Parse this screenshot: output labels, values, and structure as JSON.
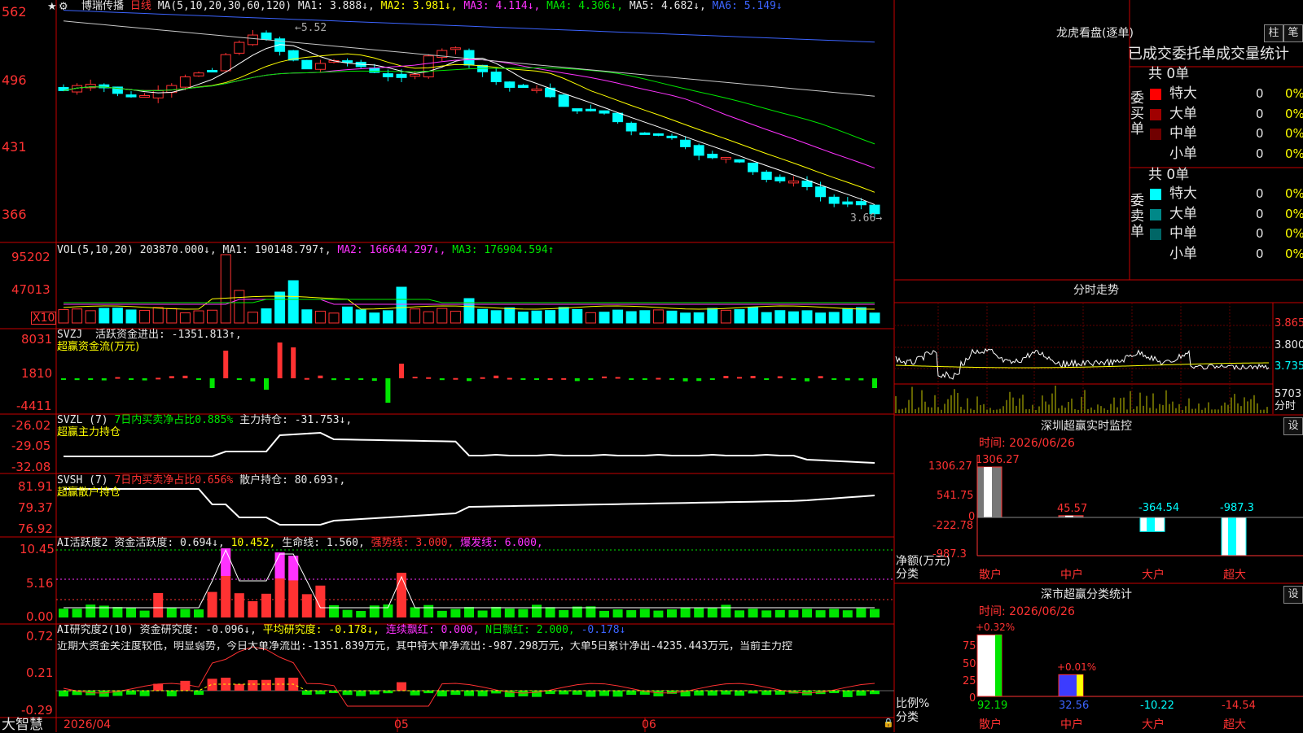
{
  "main": {
    "title_stock": "博瑞传播",
    "title_period": "日线",
    "ma_def": "MA(5,10,20,30,60,120)",
    "ma1": "MA1: 3.888↓,",
    "ma2": "MA2: 3.981↓,",
    "ma3": "MA3: 4.114↓,",
    "ma4": "MA4: 4.306↓,",
    "ma5": "MA5: 4.682↓,",
    "ma6": "MA6: 5.149↓",
    "y_labels": [
      "562",
      "496",
      "431",
      "366"
    ],
    "high_label": "5.52",
    "low_label": "3.66",
    "colors": {
      "ma1": "#ffffff",
      "ma2": "#ffff00",
      "ma3": "#ff32ff",
      "ma4": "#00e600",
      "ma5": "#c8c8c8",
      "ma6": "#3c64ff"
    }
  },
  "vol": {
    "def": "VOL(5,10,20)",
    "value": "203870.000↓,",
    "ma1": "MA1: 190148.797↑,",
    "ma2": "MA2: 166644.297↓,",
    "ma3": "MA3: 176904.594↑",
    "y_labels": [
      "95202",
      "47013"
    ],
    "unit": "X10"
  },
  "svzj": {
    "name": "SVZJ",
    "line1": "活跃资金进出: -1351.813↑,",
    "line2": "超赢资金流(万元)",
    "y_labels": [
      "8031",
      "1810",
      "-4411"
    ]
  },
  "svzl": {
    "name": "SVZL (7)",
    "ratio": "7日内买卖净占比0.885%",
    "hold": "主力持仓: -31.753↓,",
    "line2": "超赢主力持仓",
    "y_labels": [
      "-26.02",
      "-29.05",
      "-32.08"
    ]
  },
  "svsh": {
    "name": "SVSH (7)",
    "ratio": "7日内买卖净占比0.656%",
    "hold": "散户持仓: 80.693↑,",
    "line2": "超赢散户持仓",
    "y_labels": [
      "81.91",
      "79.37",
      "76.92"
    ]
  },
  "ai1": {
    "name": "AI活跃度2",
    "v1": "资金活跃度: 0.694↓,",
    "v2": "10.452,",
    "v3": "生命线: 1.560,",
    "v4": "强势线: 3.000,",
    "v5": "爆发线: 6.000,",
    "y_labels": [
      "10.45",
      "5.16",
      "0.00"
    ]
  },
  "ai2": {
    "name": "AI研究度2(10)",
    "v1": "资金研究度: -0.096↓,",
    "v2": "平均研究度: -0.178↓,",
    "v3": "连续飘红: 0.000,",
    "v4": "N日飘红: 2.000,",
    "v5": "-0.178↓",
    "comment": "近期大资金关注度较低，明显弱势，今日大单净流出:-1351.839万元，其中特大单净流出:-987.298万元，大单5日累计净出-4235.443万元，当前主力控",
    "y_labels": [
      "0.72",
      "0.21",
      "-0.29"
    ]
  },
  "bottom": {
    "brand": "大智慧",
    "dates": [
      "2026/04",
      "05",
      "06"
    ]
  },
  "longhu": {
    "title": "龙虎看盘(逐单)",
    "btn1": "柱",
    "btn2": "笔",
    "subtitle": "已成交委托单成交量统计",
    "buy_label": "委买单",
    "sell_label": "委卖单",
    "buy_total": "共 0单",
    "sell_total": "共 0单",
    "buy_rows": [
      {
        "name": "特大",
        "count": "0",
        "pct": "0%"
      },
      {
        "name": "大单",
        "count": "0",
        "pct": "0%"
      },
      {
        "name": "中单",
        "count": "0",
        "pct": "0%"
      },
      {
        "name": "小单",
        "count": "0",
        "pct": "0%"
      }
    ],
    "sell_rows": [
      {
        "name": "特大",
        "count": "0",
        "pct": "0%"
      },
      {
        "name": "大单",
        "count": "0",
        "pct": "0%"
      },
      {
        "name": "中单",
        "count": "0",
        "pct": "0%"
      },
      {
        "name": "小单",
        "count": "0",
        "pct": "0%"
      }
    ]
  },
  "fenshi": {
    "title": "分时走势",
    "y_labels": [
      "3.865",
      "3.800",
      "3.735"
    ],
    "vol_label": "5703",
    "unit": "分时"
  },
  "sz_monitor": {
    "title": "深圳超赢实时监控",
    "btn": "设",
    "time": "时间: 2026/06/26",
    "y_labels": [
      "1306.27",
      "541.75",
      "0",
      "-222.78",
      "-987.3"
    ],
    "axis_label": "净额(万元)",
    "axis_label2": "分类",
    "categories": [
      "散户",
      "中户",
      "大户",
      "超大"
    ],
    "values": [
      1306.27,
      45.57,
      -364.54,
      -987.3
    ],
    "value_labels": [
      "1306.27",
      "45.57",
      "-364.54",
      "-987.3"
    ]
  },
  "sz_class": {
    "title": "深市超赢分类统计",
    "btn": "设",
    "time": "时间: 2026/06/26",
    "y_labels": [
      "75",
      "50",
      "25",
      "0"
    ],
    "axis_label": "比例%",
    "axis_label2": "分类",
    "categories": [
      "散户",
      "中户",
      "大户",
      "超大"
    ],
    "top_labels": [
      "+0.32%",
      "+0.01%"
    ],
    "values": [
      92.19,
      32.56,
      -10.22,
      -14.54
    ],
    "value_labels": [
      "92.19",
      "32.56",
      "-10.22",
      "-14.54"
    ]
  },
  "chart_data": {
    "type": "candlestick",
    "title": "博瑞传播 日线",
    "ylim": [
      3.66,
      5.62
    ],
    "high": 5.52,
    "low": 3.66,
    "ma_last": {
      "MA1": 3.888,
      "MA2": 3.981,
      "MA3": 4.114,
      "MA4": 4.306,
      "MA5": 4.682,
      "MA6": 5.149
    }
  }
}
